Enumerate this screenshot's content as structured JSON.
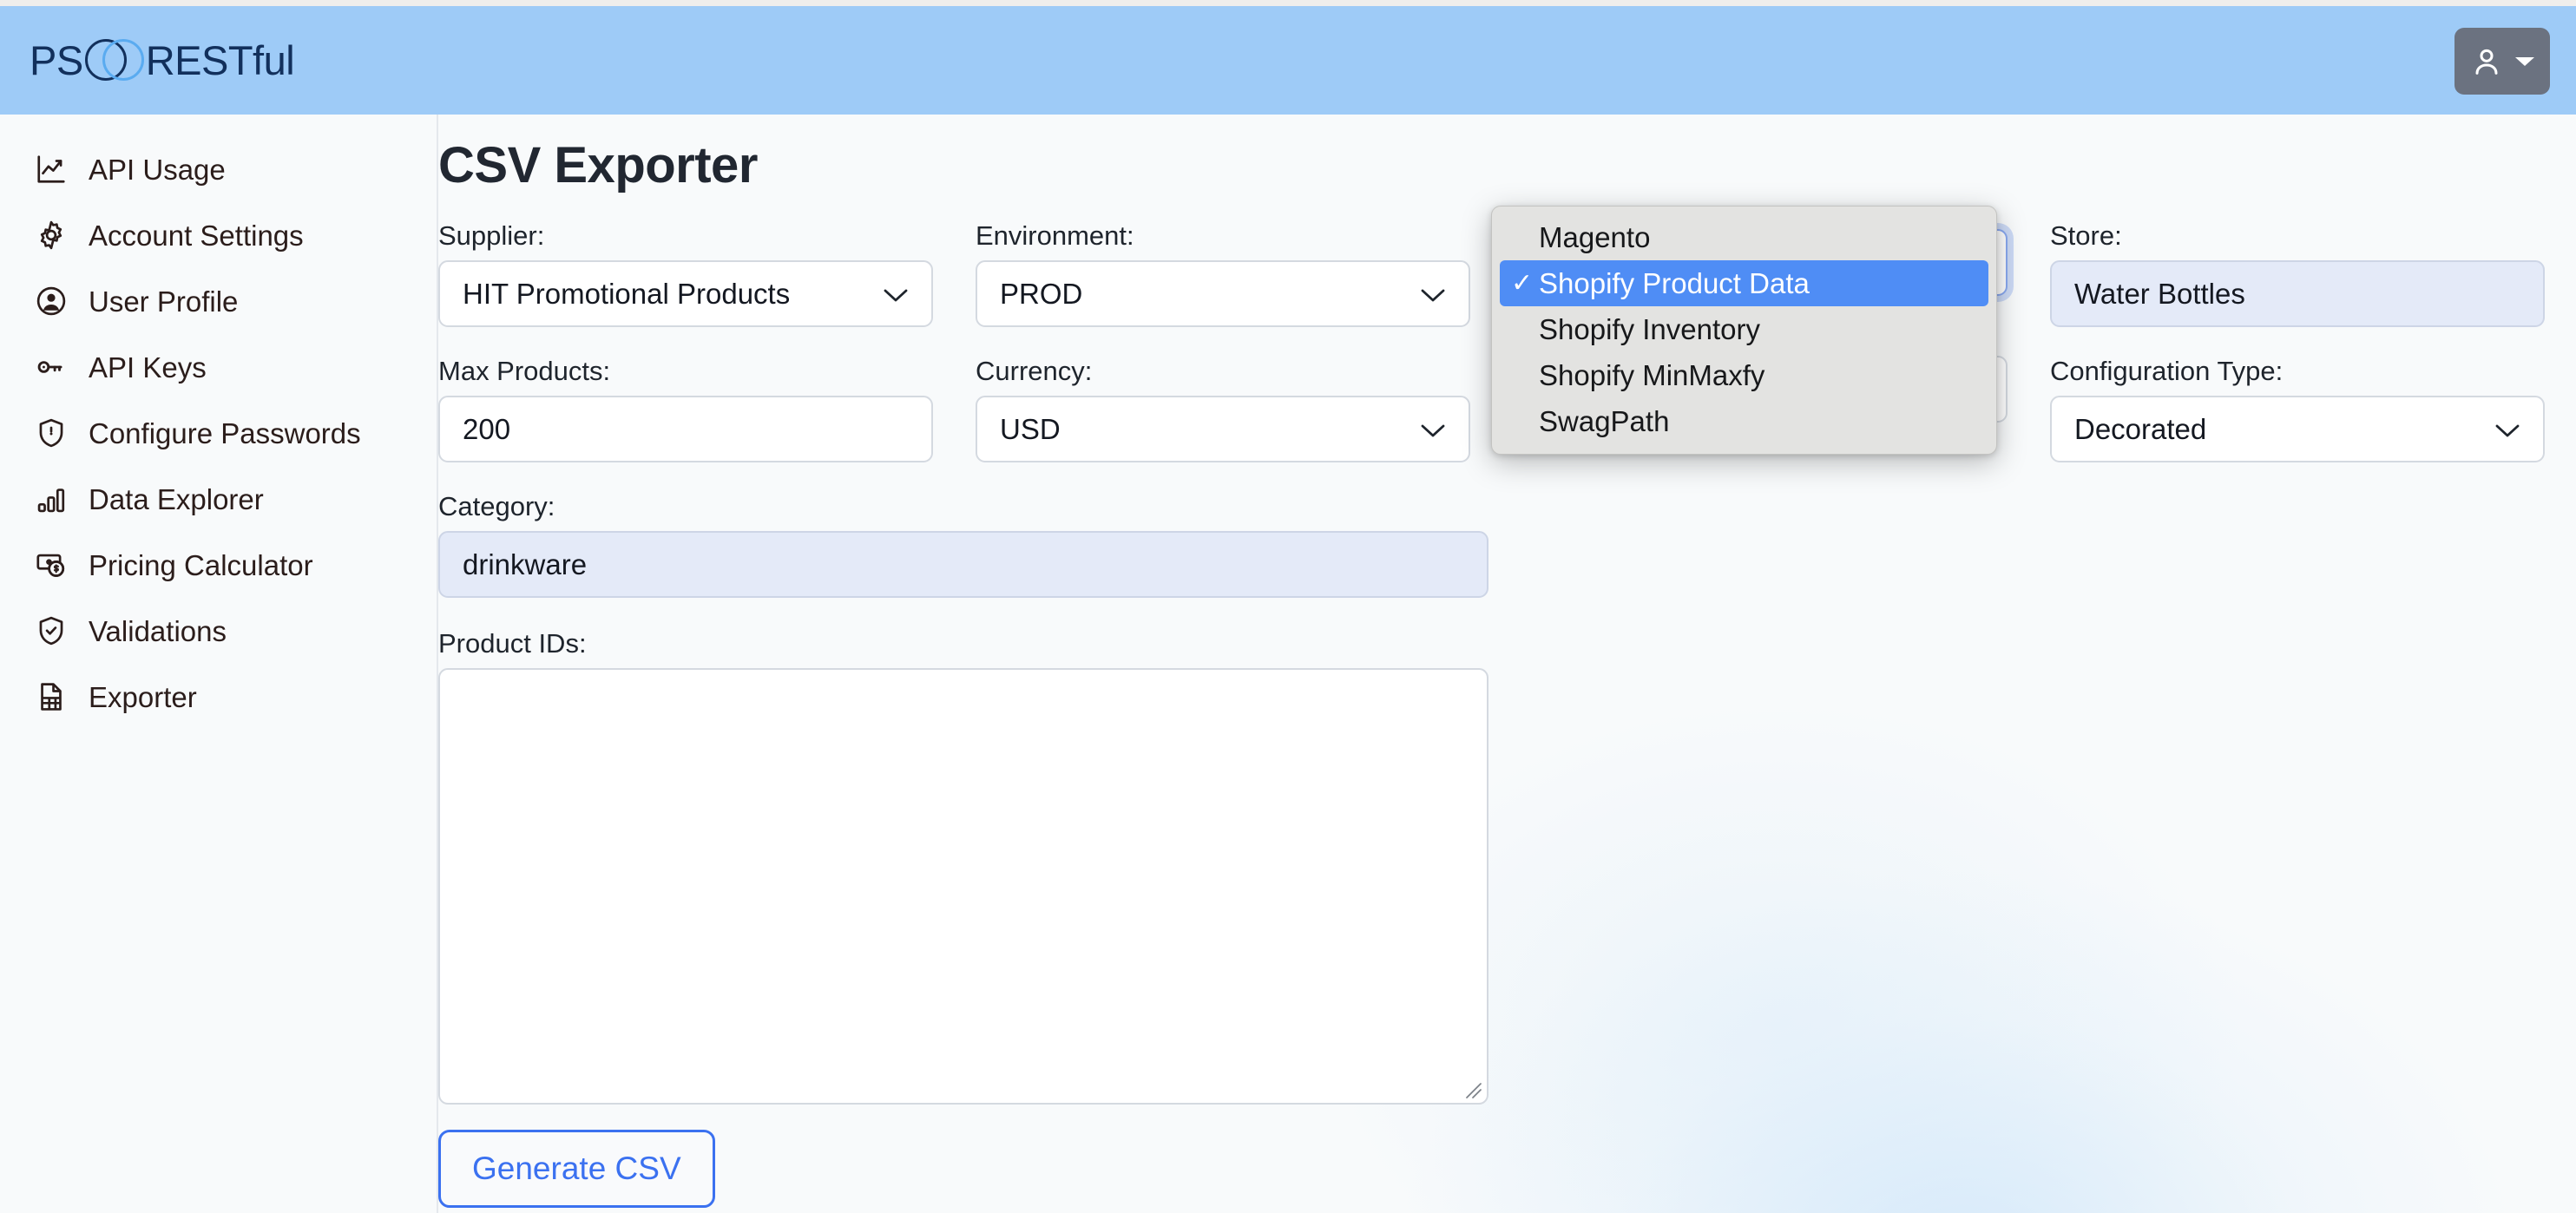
{
  "header": {
    "logo_prefix": "PS",
    "logo_suffix": "RESTful",
    "logo_mark_icon": "two-overlapping-circles-icon",
    "user_icon": "person-icon",
    "user_caret_icon": "caret-down-icon",
    "bg_color": "#9ecbf7"
  },
  "sidebar": {
    "items": [
      {
        "label": "API Usage",
        "icon": "line-chart-icon"
      },
      {
        "label": "Account Settings",
        "icon": "gear-icon"
      },
      {
        "label": "User Profile",
        "icon": "user-circle-icon"
      },
      {
        "label": "API Keys",
        "icon": "key-icon"
      },
      {
        "label": "Configure Passwords",
        "icon": "shield-lock-icon"
      },
      {
        "label": "Data Explorer",
        "icon": "bar-chart-icon"
      },
      {
        "label": "Pricing Calculator",
        "icon": "money-dollar-icon"
      },
      {
        "label": "Validations",
        "icon": "shield-check-icon"
      },
      {
        "label": "Exporter",
        "icon": "file-table-icon"
      }
    ]
  },
  "main": {
    "page_title": "CSV Exporter",
    "fields": {
      "supplier": {
        "label": "Supplier:",
        "value": "HIT Promotional Products",
        "caret_icon": "chevron-down-icon"
      },
      "environment": {
        "label": "Environment:",
        "value": "PROD",
        "caret_icon": "chevron-down-icon"
      },
      "platform": {
        "label": "",
        "value": "Shopify Product Data",
        "caret_icon": "chevron-down-icon"
      },
      "store": {
        "label": "Store:",
        "value": "Water Bottles"
      },
      "max_products": {
        "label": "Max Products:",
        "value": "200"
      },
      "currency": {
        "label": "Currency:",
        "value": "USD",
        "caret_icon": "chevron-down-icon"
      },
      "config_type": {
        "label": "Configuration Type:",
        "value": "Decorated",
        "caret_icon": "chevron-down-icon"
      },
      "category": {
        "label": "Category:",
        "value": "drinkware"
      },
      "product_ids": {
        "label": "Product IDs:",
        "value": ""
      }
    },
    "generate_button": "Generate CSV"
  },
  "select_popup": {
    "selected_index": 1,
    "check_glyph": "✓",
    "highlight_color": "#4f8df5",
    "options": [
      "Magento",
      "Shopify Product Data",
      "Shopify Inventory",
      "Shopify MinMaxfy",
      "SwagPath"
    ]
  }
}
